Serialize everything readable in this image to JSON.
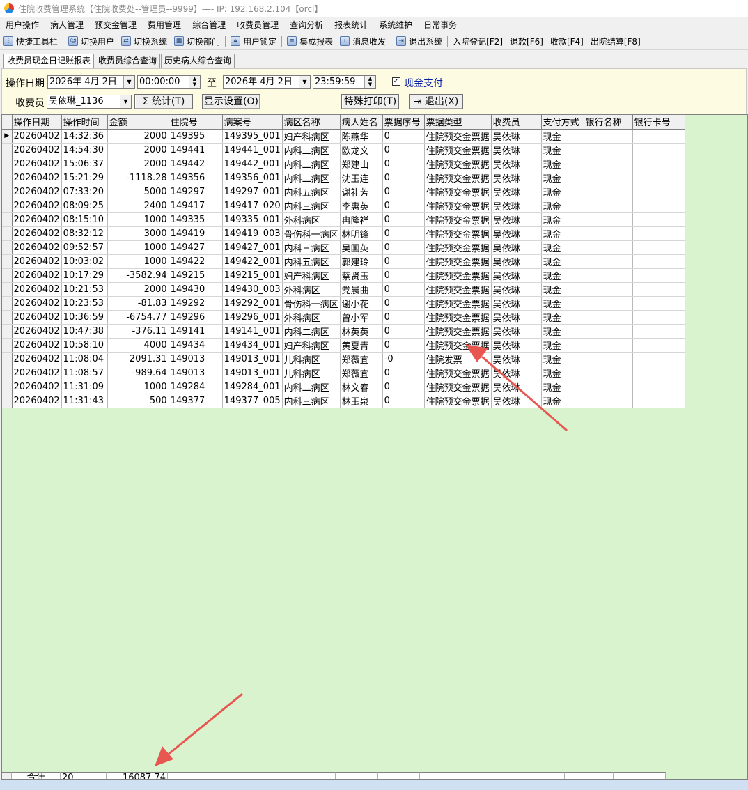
{
  "window": {
    "title": "住院收费管理系统【住院收费处--管理员--9999】---- IP: 192.168.2.104【orcl】"
  },
  "menu": [
    "用户操作",
    "病人管理",
    "预交金管理",
    "费用管理",
    "综合管理",
    "收费员管理",
    "查询分析",
    "报表统计",
    "系统维护",
    "日常事务"
  ],
  "toolbar": {
    "quick": "快捷工具栏",
    "switch_user": "切换用户",
    "switch_system": "切换系统",
    "switch_dept": "切换部门",
    "lock_user": "用户锁定",
    "integrated_report": "集成报表",
    "messages": "消息收发",
    "exit_system": "退出系统",
    "admission": "入院登记[F2]",
    "refund": "退款[F6]",
    "collect": "收款[F4]",
    "discharge": "出院结算[F8]"
  },
  "tabs": [
    "收费员现金日记账报表",
    "收费员综合查询",
    "历史病人综合查询"
  ],
  "filter": {
    "date_label": "操作日期",
    "date_from": "2026年 4月 2日",
    "time_from": "00:00:00",
    "to_label": "至",
    "date_to": "2026年 4月 2日",
    "time_to": "23:59:59",
    "cash_label": "现金支付",
    "cashier_label": "收费员",
    "cashier_value": "吴依琳_1136",
    "stat_button": "统计(T)",
    "display_button": "显示设置(O)",
    "print_button": "特殊打印(T)",
    "exit_button": "退出(X)"
  },
  "table": {
    "columns": [
      "操作日期",
      "操作时间",
      "金额",
      "住院号",
      "病案号",
      "病区名称",
      "病人姓名",
      "票据序号",
      "票据类型",
      "收费员",
      "支付方式",
      "银行名称",
      "银行卡号"
    ],
    "rows": [
      [
        "20260402",
        "14:32:36",
        "2000",
        "149395",
        "149395_001",
        "妇产科病区",
        "陈燕华",
        "0",
        "住院预交金票据",
        "吴依琳",
        "现金",
        "",
        ""
      ],
      [
        "20260402",
        "14:54:30",
        "2000",
        "149441",
        "149441_001",
        "内科二病区",
        "欧龙文",
        "0",
        "住院预交金票据",
        "吴依琳",
        "现金",
        "",
        ""
      ],
      [
        "20260402",
        "15:06:37",
        "2000",
        "149442",
        "149442_001",
        "内科二病区",
        "郑建山",
        "0",
        "住院预交金票据",
        "吴依琳",
        "现金",
        "",
        ""
      ],
      [
        "20260402",
        "15:21:29",
        "-1118.28",
        "149356",
        "149356_001",
        "内科二病区",
        "沈玉连",
        "0",
        "住院预交金票据",
        "吴依琳",
        "现金",
        "",
        ""
      ],
      [
        "20260402",
        "07:33:20",
        "5000",
        "149297",
        "149297_001",
        "内科五病区",
        "谢礼芳",
        "0",
        "住院预交金票据",
        "吴依琳",
        "现金",
        "",
        ""
      ],
      [
        "20260402",
        "08:09:25",
        "2400",
        "149417",
        "149417_020",
        "内科三病区",
        "李惠英",
        "0",
        "住院预交金票据",
        "吴依琳",
        "现金",
        "",
        ""
      ],
      [
        "20260402",
        "08:15:10",
        "1000",
        "149335",
        "149335_001",
        "外科病区",
        "冉隆祥",
        "0",
        "住院预交金票据",
        "吴依琳",
        "现金",
        "",
        ""
      ],
      [
        "20260402",
        "08:32:12",
        "3000",
        "149419",
        "149419_003",
        "骨伤科一病区",
        "林明锋",
        "0",
        "住院预交金票据",
        "吴依琳",
        "现金",
        "",
        ""
      ],
      [
        "20260402",
        "09:52:57",
        "1000",
        "149427",
        "149427_001",
        "内科三病区",
        "吴国英",
        "0",
        "住院预交金票据",
        "吴依琳",
        "现金",
        "",
        ""
      ],
      [
        "20260402",
        "10:03:02",
        "1000",
        "149422",
        "149422_001",
        "内科五病区",
        "郭建玲",
        "0",
        "住院预交金票据",
        "吴依琳",
        "现金",
        "",
        ""
      ],
      [
        "20260402",
        "10:17:29",
        "-3582.94",
        "149215",
        "149215_001",
        "妇产科病区",
        "蔡贤玉",
        "0",
        "住院预交金票据",
        "吴依琳",
        "现金",
        "",
        ""
      ],
      [
        "20260402",
        "10:21:53",
        "2000",
        "149430",
        "149430_003",
        "外科病区",
        "党晨曲",
        "0",
        "住院预交金票据",
        "吴依琳",
        "现金",
        "",
        ""
      ],
      [
        "20260402",
        "10:23:53",
        "-81.83",
        "149292",
        "149292_001",
        "骨伤科一病区",
        "谢小花",
        "0",
        "住院预交金票据",
        "吴依琳",
        "现金",
        "",
        ""
      ],
      [
        "20260402",
        "10:36:59",
        "-6754.77",
        "149296",
        "149296_001",
        "外科病区",
        "曾小军",
        "0",
        "住院预交金票据",
        "吴依琳",
        "现金",
        "",
        ""
      ],
      [
        "20260402",
        "10:47:38",
        "-376.11",
        "149141",
        "149141_001",
        "内科二病区",
        "林英英",
        "0",
        "住院预交金票据",
        "吴依琳",
        "现金",
        "",
        ""
      ],
      [
        "20260402",
        "10:58:10",
        "4000",
        "149434",
        "149434_001",
        "妇产科病区",
        "黄夏青",
        "0",
        "住院预交金票据",
        "吴依琳",
        "现金",
        "",
        ""
      ],
      [
        "20260402",
        "11:08:04",
        "2091.31",
        "149013",
        "149013_001",
        "儿科病区",
        "郑薇宜",
        "-0",
        "住院发票",
        "吴依琳",
        "现金",
        "",
        ""
      ],
      [
        "20260402",
        "11:08:57",
        "-989.64",
        "149013",
        "149013_001",
        "儿科病区",
        "郑薇宜",
        "0",
        "住院预交金票据",
        "吴依琳",
        "现金",
        "",
        ""
      ],
      [
        "20260402",
        "11:31:09",
        "1000",
        "149284",
        "149284_001",
        "内科二病区",
        "林文春",
        "0",
        "住院预交金票据",
        "吴依琳",
        "现金",
        "",
        ""
      ],
      [
        "20260402",
        "11:31:43",
        "500",
        "149377",
        "149377_005",
        "内科三病区",
        "林玉泉",
        "0",
        "住院预交金票据",
        "吴依琳",
        "现金",
        "",
        ""
      ]
    ]
  },
  "footer": {
    "label": "合计",
    "count": "20",
    "total": "16087.74"
  },
  "colors": {
    "grid_bg": "#d9f3cf",
    "filter_bg": "#fdfbe1",
    "arrow": "#e8574f"
  }
}
